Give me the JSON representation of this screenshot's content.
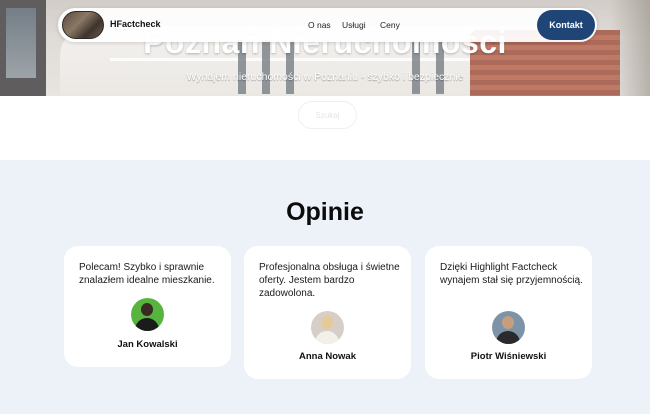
{
  "navbar": {
    "logo_text": "HFactcheck",
    "links": [
      "O nas",
      "Usługi",
      "Ceny"
    ],
    "cta_label": "Kontakt"
  },
  "hero": {
    "title": "Poznań Nieruchomości",
    "subtitle": "Wynajem nieruchomości w Poznaniu - szybko i bezpiecznie",
    "button_label": "Szukaj"
  },
  "opinions": {
    "title": "Opinie",
    "items": [
      {
        "quote": "Polecam! Szybko i sprawnie znalazłem idealne mieszkanie.",
        "name": "Jan Kowalski"
      },
      {
        "quote": "Profesjonalna obsługa i świetne oferty. Jestem bardzo zadowolona.",
        "name": "Anna Nowak"
      },
      {
        "quote": "Dzięki Highlight Factcheck wynajem stał się przyjemnością.",
        "name": "Piotr Wiśniewski"
      }
    ]
  },
  "colors": {
    "accent": "#1f4476",
    "section_bg": "#ecf2f8",
    "card_bg": "#ffffff"
  }
}
